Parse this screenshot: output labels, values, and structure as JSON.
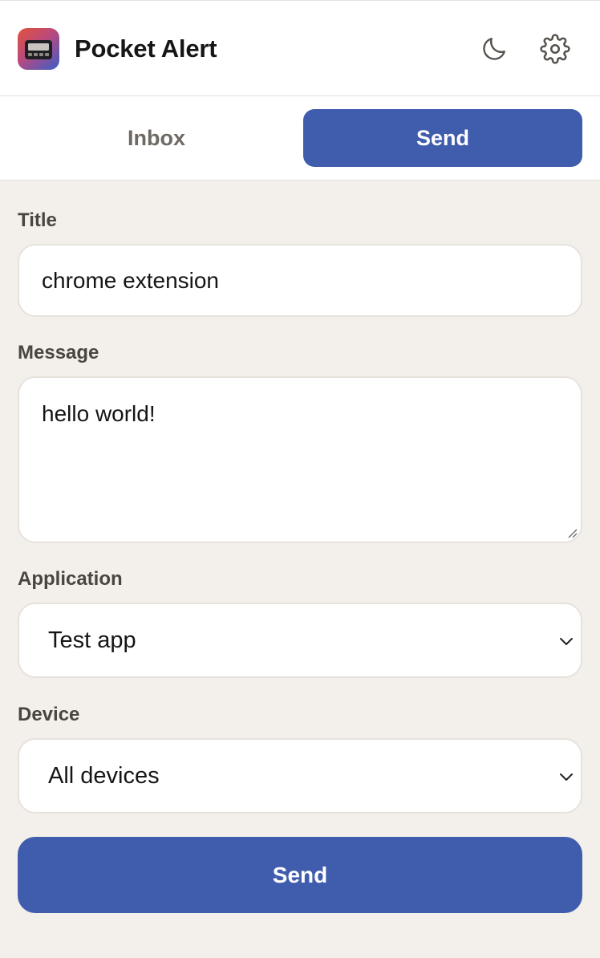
{
  "header": {
    "title": "Pocket Alert",
    "icons": {
      "logo": "pager-logo-icon",
      "theme": "moon-icon",
      "settings": "gear-icon"
    }
  },
  "tabs": [
    {
      "label": "Inbox",
      "active": false
    },
    {
      "label": "Send",
      "active": true
    }
  ],
  "form": {
    "title": {
      "label": "Title",
      "value": "chrome extension"
    },
    "message": {
      "label": "Message",
      "value": "hello world!"
    },
    "application": {
      "label": "Application",
      "selected": "Test app"
    },
    "device": {
      "label": "Device",
      "selected": "All devices"
    },
    "submit_label": "Send"
  },
  "colors": {
    "accent": "#405cad",
    "background": "#f3f0eb",
    "surface": "#ffffff",
    "label": "#4a4540",
    "inactive_tab": "#6e6a63"
  }
}
